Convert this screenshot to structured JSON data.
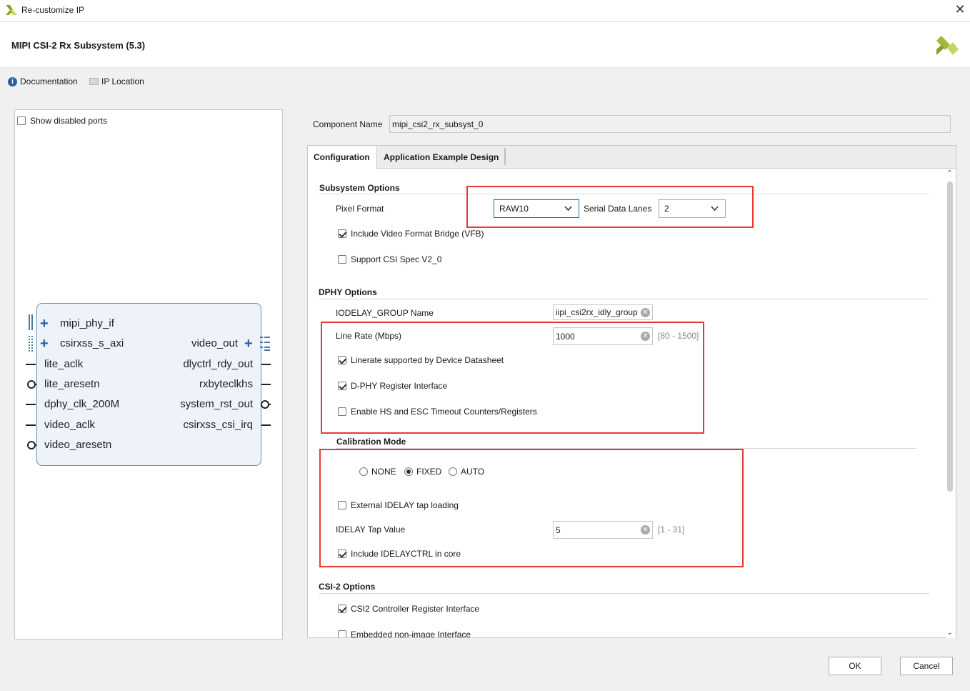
{
  "window": {
    "title": "Re-customize IP"
  },
  "header": {
    "ip_title": "MIPI CSI-2 Rx Subsystem (5.3)",
    "documentation": "Documentation",
    "ip_location": "IP Location"
  },
  "left_panel": {
    "show_disabled_ports": "Show disabled ports"
  },
  "block": {
    "left_ports": [
      "mipi_phy_if",
      "csirxss_s_axi",
      "lite_aclk",
      "lite_aresetn",
      "dphy_clk_200M",
      "video_aclk",
      "video_aresetn"
    ],
    "right_ports": [
      "video_out",
      "dlyctrl_rdy_out",
      "rxbyteclkhs",
      "system_rst_out",
      "csirxss_csi_irq"
    ]
  },
  "component": {
    "label": "Component Name",
    "value": "mipi_csi2_rx_subsyst_0"
  },
  "tabs": [
    "Configuration",
    "Application Example Design"
  ],
  "subsystem": {
    "title": "Subsystem Options",
    "pixel_format_label": "Pixel Format",
    "pixel_format_value": "RAW10",
    "lanes_label": "Serial Data Lanes",
    "lanes_value": "2",
    "vfb_label": "Include Video Format Bridge (VFB)",
    "csi_v2_label": "Support CSI Spec V2_0"
  },
  "dphy": {
    "title": "DPHY Options",
    "iodelay_label": "IODELAY_GROUP Name",
    "iodelay_value": "iipi_csi2rx_idly_group",
    "line_rate_label": "Line Rate (Mbps)",
    "line_rate_value": "1000",
    "line_rate_range": "[80 - 1500]",
    "datasheet_label": "Linerate supported by Device Datasheet",
    "reg_iface_label": "D-PHY Register Interface",
    "timeout_label": "Enable HS and ESC Timeout Counters/Registers"
  },
  "calibration": {
    "title": "Calibration Mode",
    "none": "NONE",
    "fixed": "FIXED",
    "auto": "AUTO",
    "ext_tap_label": "External IDELAY tap loading",
    "tap_label": "IDELAY Tap Value",
    "tap_value": "5",
    "tap_range": "[1 - 31]",
    "idelayctrl_label": "Include IDELAYCTRL in core"
  },
  "csi2": {
    "title": "CSI-2 Options",
    "ctrl_reg_label": "CSI2 Controller Register Interface",
    "embedded_label": "Embedded non-image Interface"
  },
  "buttons": {
    "ok": "OK",
    "cancel": "Cancel"
  },
  "colors": {
    "highlight": "#e53935",
    "logo": "#a4b83a"
  }
}
